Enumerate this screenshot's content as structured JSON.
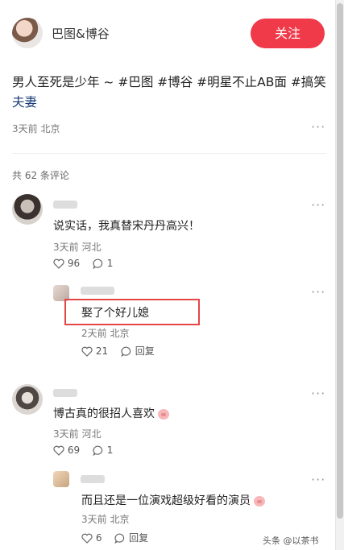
{
  "post": {
    "author": "巴图&博谷",
    "follow_label": "关注",
    "text_line1": "男人至死是少年 ~ #巴图 #博谷 #明星不止AB面 #搞笑",
    "text_line2": "夫妻",
    "meta": "3天前 北京",
    "more": "···"
  },
  "comments_header": "共 62 条评论",
  "comments": [
    {
      "text": "说实话，我真替宋丹丹高兴！",
      "meta": "3天前 河北",
      "likes": "96",
      "replies": "1",
      "more": "···",
      "reply": {
        "text": "娶了个好儿媳",
        "meta": "2天前 北京",
        "likes": "21",
        "reply_label": "回复",
        "more": "···"
      }
    },
    {
      "text": "博古真的很招人喜欢",
      "meta": "3天前 河北",
      "likes": "69",
      "replies": "1",
      "more": "···",
      "reply": {
        "text": "而且还是一位演戏超级好看的演员",
        "meta": "3天前 北京",
        "likes": "6",
        "reply_label": "回复",
        "more": "···"
      }
    }
  ],
  "watermark": "头条 @以茶书",
  "colors": {
    "follow": "#f03a4a",
    "highlight_box": "#e64545",
    "tag": "#1a3c7a"
  }
}
